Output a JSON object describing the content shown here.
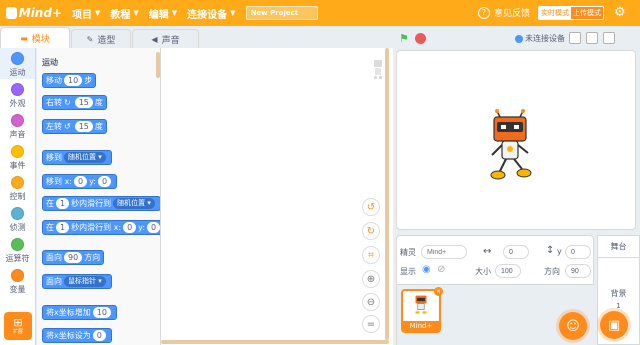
{
  "app": {
    "logo_text": "Mind+"
  },
  "menu": {
    "items": [
      {
        "label": "项目"
      },
      {
        "label": "教程"
      },
      {
        "label": "编辑"
      },
      {
        "label": "连接设备"
      }
    ],
    "project_name": "New Project",
    "feedback_label": "意见反馈",
    "mode_realtime": "实时模式",
    "mode_upload": "上传模式"
  },
  "tabs": [
    {
      "label": "模块",
      "active": true
    },
    {
      "label": "造型",
      "active": false
    },
    {
      "label": "声音",
      "active": false
    }
  ],
  "categories": [
    {
      "label": "运动",
      "color": "#4c97ff"
    },
    {
      "label": "外观",
      "color": "#9966ff"
    },
    {
      "label": "声音",
      "color": "#cf63cf"
    },
    {
      "label": "事件",
      "color": "#ffbf00"
    },
    {
      "label": "控制",
      "color": "#ffab19"
    },
    {
      "label": "侦测",
      "color": "#5cb1d6"
    },
    {
      "label": "运算符",
      "color": "#59c059"
    },
    {
      "label": "变量",
      "color": "#ff8c1a"
    }
  ],
  "extension_label": "扩展",
  "palette": {
    "title": "运动",
    "blocks": {
      "move": {
        "pre": "移动",
        "val": "10",
        "post": "步"
      },
      "turn_right": {
        "pre": "右转",
        "val": "15",
        "post": "度"
      },
      "turn_left": {
        "pre": "左转",
        "val": "15",
        "post": "度"
      },
      "goto": {
        "pre": "移到",
        "drop": "随机位置"
      },
      "goto_xy": {
        "pre": "移到 x:",
        "x": "0",
        "mid": "y:",
        "y": "0"
      },
      "glide": {
        "pre": "在",
        "val": "1",
        "mid": "秒内滑行到",
        "drop": "随机位置"
      },
      "glide_xy": {
        "pre": "在",
        "val": "1",
        "mid": "秒内滑行到 x:",
        "x": "0",
        "mid2": "y:",
        "y": "0"
      },
      "point_dir": {
        "pre": "面向",
        "val": "90",
        "post": "方向"
      },
      "point_towards": {
        "pre": "面向",
        "drop": "鼠标指针"
      },
      "change_x": {
        "pre": "将x坐标增加",
        "val": "10"
      },
      "set_x": {
        "pre": "将x坐标设为",
        "val": "0"
      }
    }
  },
  "stage_header": {
    "connection": "未连接设备"
  },
  "sprite_info": {
    "sprite_label": "精灵",
    "sprite_name_placeholder": "Mind+",
    "x_value": "0",
    "y_label": "y",
    "y_value": "0",
    "show_label": "显示",
    "size_label": "大小",
    "size_value": "100",
    "direction_label": "方向",
    "direction_value": "90"
  },
  "sprites": [
    {
      "name": "Mind+"
    }
  ],
  "stage_pane": {
    "title": "舞台",
    "backdrop_label": "背景",
    "backdrop_count": "1"
  }
}
